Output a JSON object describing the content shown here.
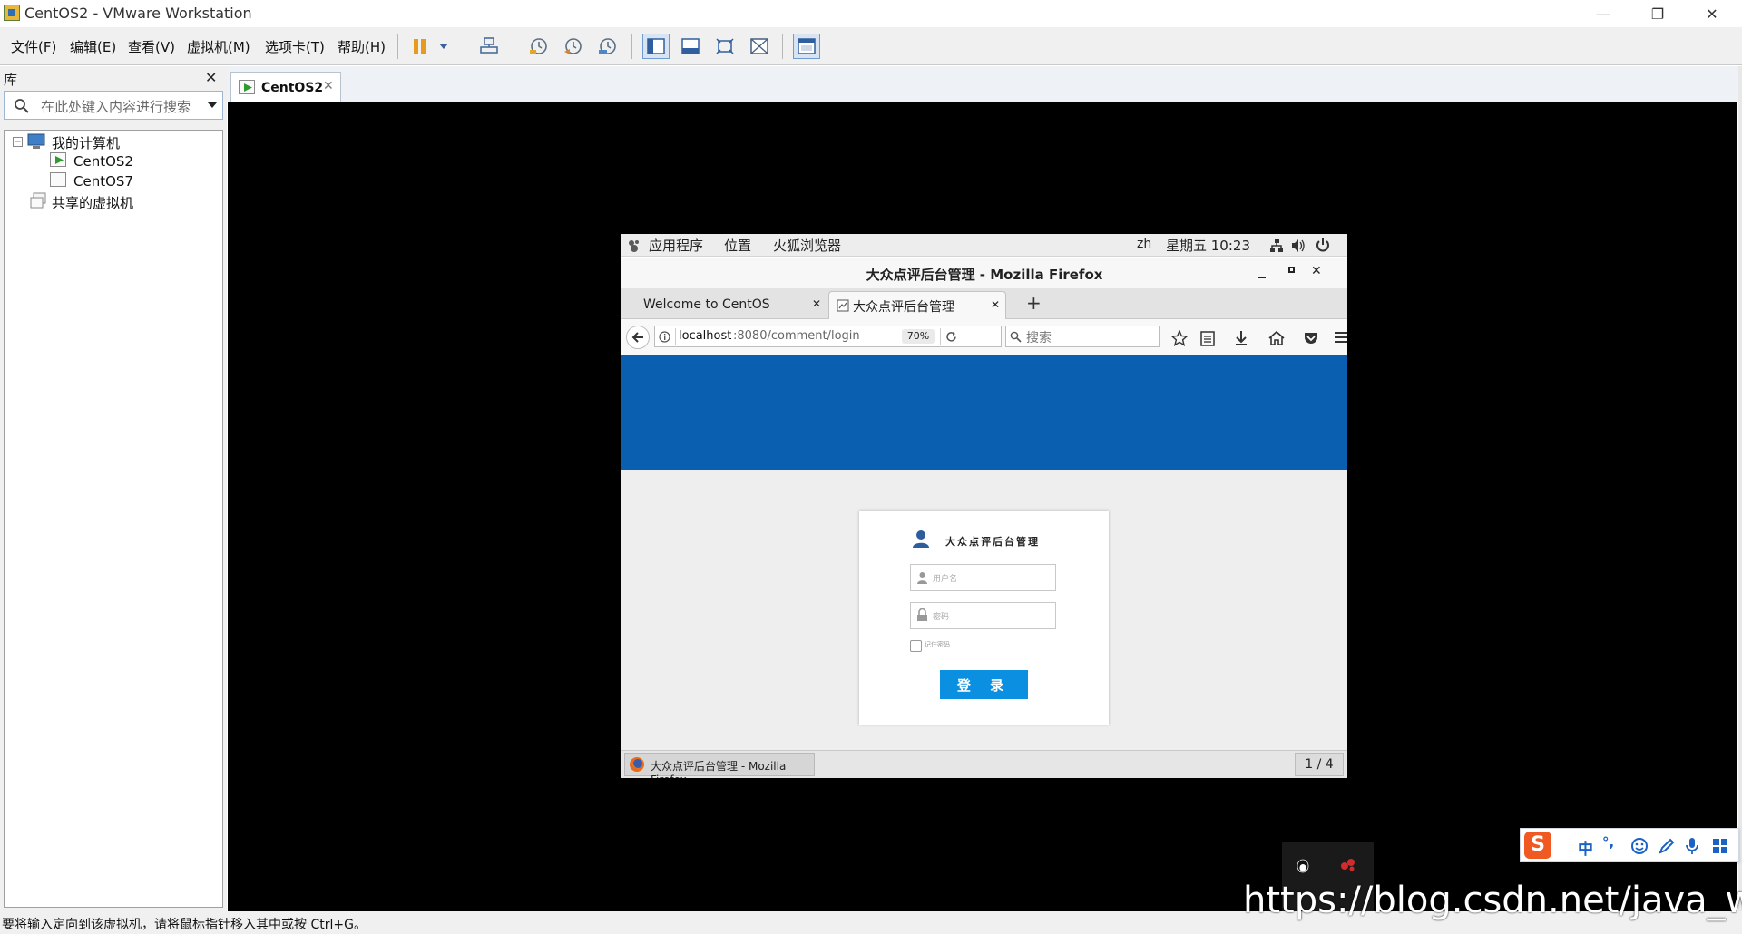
{
  "window": {
    "title": "CentOS2 - VMware Workstation",
    "minimize": "—",
    "restore": "❐",
    "close": "✕"
  },
  "menu": [
    "文件(F)",
    "编辑(E)",
    "查看(V)",
    "虚拟机(M)",
    "选项卡(T)",
    "帮助(H)"
  ],
  "library": {
    "title": "库",
    "close": "✕",
    "search_placeholder": "在此处键入内容进行搜索",
    "tree": {
      "root": "我的计算机",
      "expander": "−",
      "vms": [
        "CentOS2",
        "CentOS7"
      ],
      "shared": "共享的虚拟机"
    }
  },
  "vm_tab": {
    "label": "CentOS2",
    "close": "✕"
  },
  "guest": {
    "gnome": {
      "applications": "应用程序",
      "places": "位置",
      "browser": "火狐浏览器",
      "lang": "zh",
      "clock": "星期五 10:23"
    },
    "firefox": {
      "title": "大众点评后台管理  -  Mozilla Firefox",
      "tabs": [
        {
          "label": "Welcome to CentOS"
        },
        {
          "label": "大众点评后台管理"
        }
      ],
      "tab_close": "✕",
      "new_tab": "+",
      "url_host": "localhost",
      "url_path": ":8080/comment/login",
      "zoom": "70%",
      "search_placeholder": "搜索"
    },
    "login": {
      "title": "大众点评后台管理",
      "username_placeholder": "用户名",
      "password_placeholder": "密码",
      "remember": "记住密码",
      "submit": "登 录"
    },
    "taskbar": {
      "window_label": "大众点评后台管理 - Mozilla Firefox",
      "workspace": "1 / 4"
    }
  },
  "statusbar": {
    "text": "要将输入定向到该虚拟机，请将鼠标指针移入其中或按 Ctrl+G。"
  },
  "ime": {
    "items": [
      "中",
      "°,"
    ]
  },
  "overlay": {
    "watermark": "https://blog.csdn.net/java_wxid"
  },
  "colors": {
    "banner": "#0b5fb0",
    "login_button": "#0b8fe0",
    "console_bg": "#000000"
  }
}
